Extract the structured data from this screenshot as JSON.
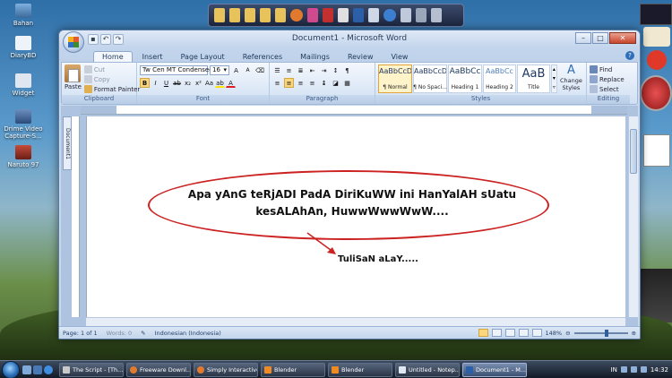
{
  "desktop": {
    "icons": [
      {
        "label": "Bahan"
      },
      {
        "label": "DiaryBD"
      },
      {
        "label": "Widget"
      },
      {
        "label": "Drime Video Capture-S..."
      },
      {
        "label": "Naruto 97"
      }
    ]
  },
  "window": {
    "title": "Document1 - Microsoft Word",
    "tabs": [
      "Home",
      "Insert",
      "Page Layout",
      "References",
      "Mailings",
      "Review",
      "View"
    ],
    "active_tab": "Home"
  },
  "ribbon": {
    "clipboard": {
      "paste": "Paste",
      "cut": "Cut",
      "copy": "Copy",
      "format_painter": "Format Painter",
      "label": "Clipboard"
    },
    "font": {
      "family": "Tw Cen MT Condensed",
      "size": "16",
      "label": "Font"
    },
    "paragraph": {
      "label": "Paragraph"
    },
    "styles": {
      "items": [
        {
          "sample": "AaBbCcDc",
          "name": "¶ Normal"
        },
        {
          "sample": "AaBbCcDc",
          "name": "¶ No Spaci..."
        },
        {
          "sample": "AaBbCc",
          "name": "Heading 1"
        },
        {
          "sample": "AaBbCc",
          "name": "Heading 2"
        },
        {
          "sample": "AaB",
          "name": "Title"
        }
      ],
      "change_styles": "Change Styles",
      "label": "Styles"
    },
    "editing": {
      "find": "Find",
      "replace": "Replace",
      "select": "Select",
      "label": "Editing"
    }
  },
  "document": {
    "tab_label": "Document1",
    "bubble_text": "Apa yAnG teRjADI PadA DiriKuWW ini HanYalAH sUatu kesALAhAn, HuwwWwwWwW....",
    "caption": "TuliSaN aLaY....."
  },
  "statusbar": {
    "page": "Page: 1 of 1",
    "words": "Words: 0",
    "language": "Indonesian (Indonesia)",
    "zoom": "148%"
  },
  "taskbar": {
    "tasks": [
      {
        "label": "The Script - [Th..."
      },
      {
        "label": "Freeware Downl..."
      },
      {
        "label": "Simply Interactive"
      },
      {
        "label": "Blender"
      },
      {
        "label": "Blender"
      },
      {
        "label": "Untitled - Notep..."
      },
      {
        "label": "Document1 - M..."
      }
    ],
    "lang": "IN",
    "time": "14:32"
  },
  "colors": {
    "ellipse": "#cc2222",
    "ribbon_accent": "#fbd67e"
  }
}
